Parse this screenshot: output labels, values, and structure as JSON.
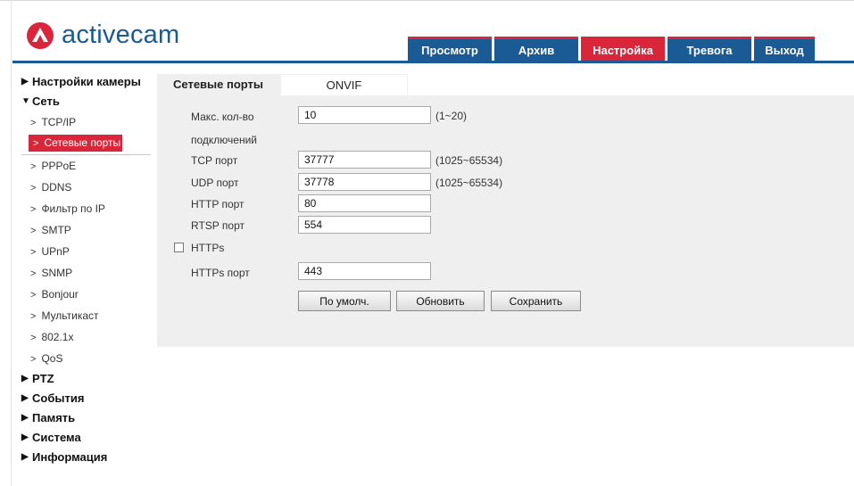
{
  "brand": {
    "logo_text": "activecam",
    "logo_color": "#1a5a95",
    "accent_color": "#d9263b"
  },
  "nav": {
    "tabs": [
      "Просмотр",
      "Архив",
      "Настройка",
      "Тревога",
      "Выход"
    ],
    "active": "Настройка"
  },
  "sidebar": {
    "groups": [
      {
        "label": "Настройки камеры"
      },
      {
        "label": "Сеть",
        "expanded": true,
        "items": [
          "TCP/IP",
          "Сетевые порты",
          "PPPoE",
          "DDNS",
          "Фильтр по IP",
          "SMTP",
          "UPnP",
          "SNMP",
          "Bonjour",
          "Мультикаст",
          "802.1x",
          "QoS"
        ]
      },
      {
        "label": "PTZ"
      },
      {
        "label": "События"
      },
      {
        "label": "Память"
      },
      {
        "label": "Система"
      },
      {
        "label": "Информация"
      }
    ],
    "active_item": "Сетевые порты"
  },
  "tabs": [
    "Сетевые порты",
    "ONVIF"
  ],
  "form": {
    "max_connections": {
      "label_line1": "Макс. кол-во",
      "label_line2": "подключений",
      "value": "10",
      "range": "(1~20)"
    },
    "tcp_port": {
      "label": "TCP порт",
      "value": "37777",
      "range": "(1025~65534)"
    },
    "udp_port": {
      "label": "UDP порт",
      "value": "37778",
      "range": "(1025~65534)"
    },
    "http_port": {
      "label": "HTTP порт",
      "value": "80"
    },
    "rtsp_port": {
      "label": "RTSP порт",
      "value": "554"
    },
    "https": {
      "label": "HTTPs",
      "checked": false
    },
    "https_port": {
      "label": "HTTPs порт",
      "value": "443"
    }
  },
  "buttons": {
    "default": "По умолч.",
    "refresh": "Обновить",
    "save": "Сохранить"
  }
}
